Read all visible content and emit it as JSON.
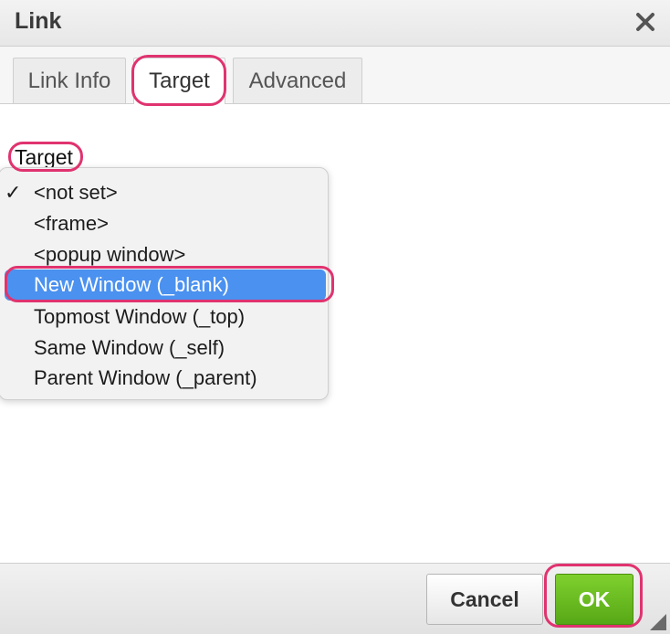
{
  "dialog": {
    "title": "Link",
    "close_icon": "close-icon"
  },
  "tabs": [
    {
      "label": "Link Info",
      "active": false
    },
    {
      "label": "Target",
      "active": true
    },
    {
      "label": "Advanced",
      "active": false
    }
  ],
  "target": {
    "label": "Target",
    "checked_value": "<not set>",
    "highlighted_value": "New Window (_blank)",
    "options": [
      "<not set>",
      "<frame>",
      "<popup window>",
      "New Window (_blank)",
      "Topmost Window (_top)",
      "Same Window (_self)",
      "Parent Window (_parent)"
    ]
  },
  "footer": {
    "cancel_label": "Cancel",
    "ok_label": "OK"
  },
  "colors": {
    "highlight": "#e0336f",
    "selection": "#4a91f0",
    "ok_button": "#6cbf22"
  }
}
